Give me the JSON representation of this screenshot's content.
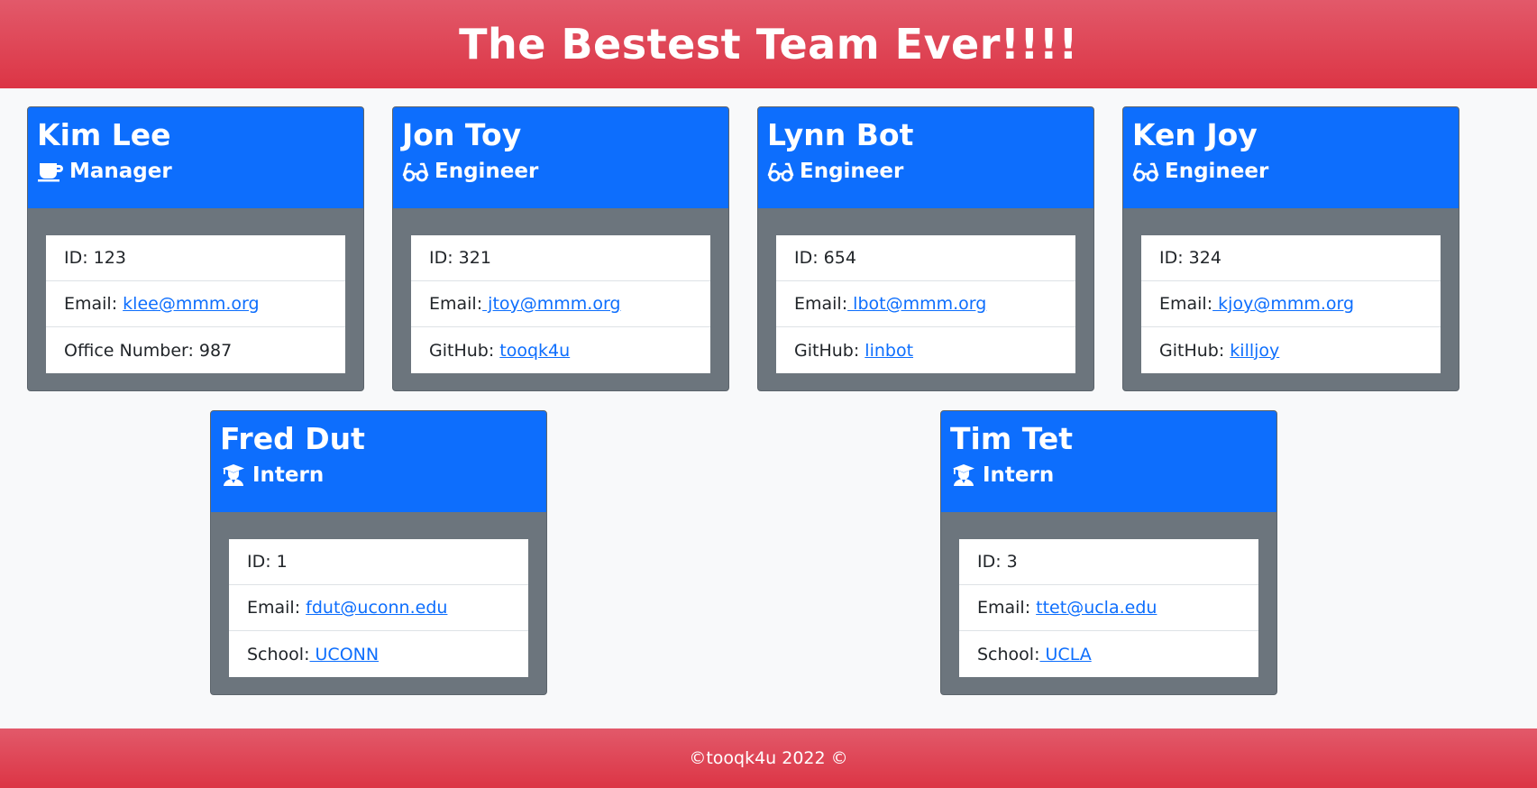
{
  "header": {
    "title": "The Bestest Team Ever!!!!"
  },
  "cards": [
    {
      "name": "Kim Lee",
      "role": "Manager",
      "icon": "coffee-icon",
      "id_text": "ID: 123",
      "email_label": "Email: ",
      "email": "klee@mmm.org",
      "third_label": "Office Number: 987",
      "third_link": ""
    },
    {
      "name": "Jon Toy",
      "role": "Engineer",
      "icon": "glasses-icon",
      "id_text": "ID: 321",
      "email_label": "Email:",
      "email": " jtoy@mmm.org",
      "third_label": "GitHub: ",
      "third_link": "tooqk4u"
    },
    {
      "name": "Lynn Bot",
      "role": "Engineer",
      "icon": "glasses-icon",
      "id_text": "ID: 654",
      "email_label": "Email:",
      "email": " lbot@mmm.org",
      "third_label": "GitHub: ",
      "third_link": "linbot"
    },
    {
      "name": "Ken Joy",
      "role": "Engineer",
      "icon": "glasses-icon",
      "id_text": "ID: 324",
      "email_label": "Email:",
      "email": " kjoy@mmm.org",
      "third_label": "GitHub: ",
      "third_link": "killjoy"
    },
    {
      "name": "Fred Dut",
      "role": "Intern",
      "icon": "graduate-icon",
      "id_text": "ID: 1",
      "email_label": "Email: ",
      "email": "fdut@uconn.edu",
      "third_label": "School:",
      "third_link": " UCONN"
    },
    {
      "name": "Tim Tet",
      "role": "Intern",
      "icon": "graduate-icon",
      "id_text": "ID: 3",
      "email_label": "Email: ",
      "email": "ttet@ucla.edu",
      "third_label": "School:",
      "third_link": " UCLA"
    }
  ],
  "footer": {
    "text": "©tooqk4u 2022 ©"
  },
  "colors": {
    "banner": "#dc3545",
    "card_header": "#0d6efd",
    "card_body": "#6c757d",
    "link": "#0d6efd"
  }
}
